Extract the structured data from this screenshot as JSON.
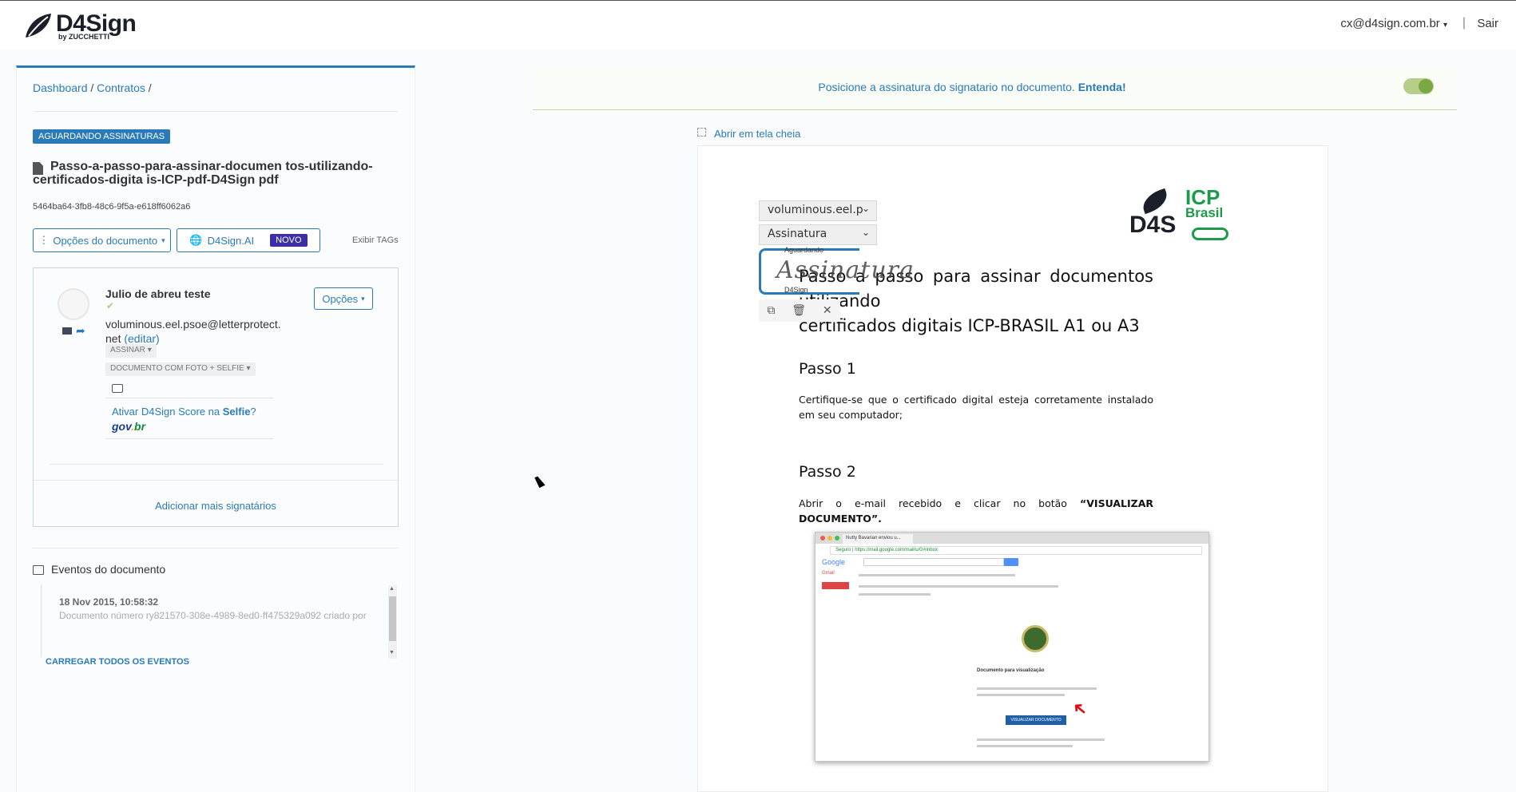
{
  "header": {
    "logo_text": "D4Sign",
    "logo_sub": "by ZUCCHETTI",
    "user_email": "cx@d4sign.com.br",
    "separator": "|",
    "logout": "Sair"
  },
  "breadcrumb": {
    "items": [
      "Dashboard",
      "Contratos"
    ],
    "sep": "/"
  },
  "document": {
    "status": "AGUARDANDO ASSINATURAS",
    "title": "Passo-a-passo-para-assinar-documen tos-utilizando-certificados-digita is-ICP-pdf-D4Sign pdf",
    "hash": "5464ba64-3fb8-48c6-9f5a-e618ff6062a6",
    "options_label": "Opções do documento",
    "ai_label": "D4Sign.AI",
    "ai_badge": "NOVO",
    "tags_label": "Exibir TAGs"
  },
  "signer": {
    "name": "Julio de abreu teste",
    "options_label": "Opções",
    "email": "voluminous.eel.psoe@letterprotect.net",
    "edit_label": "(editar)",
    "action_chip": "ASSINAR",
    "auth_chip": "DOCUMENTO COM FOTO + SELFIE",
    "score_prefix": "Ativar D4Sign Score na ",
    "score_bold": "Selfie",
    "score_suffix": "?",
    "gov_1": "gov",
    "gov_2": ".",
    "gov_3": "br",
    "add_signers": "Adicionar mais signatários"
  },
  "events": {
    "title": "Eventos do documento",
    "first_date": "18 Nov 2015, 10:58:32",
    "first_text": "Documento número ry821570-308e-4989-8ed0-ff475329a092 criado por",
    "load_all": "CARREGAR TODOS OS EVENTOS"
  },
  "viewer": {
    "info_text": "Posicione a assinatura do signatario no documento.",
    "info_link": "Entenda!",
    "fullscreen": "Abrir em tela cheia",
    "select_signer": "voluminous.eel.p",
    "select_type": "Assinatura",
    "sig_top": "Aguardando",
    "sig_script": "Assinatura",
    "sig_bottom": "D4Sign"
  },
  "doc_content": {
    "d4s_logo": "D4S",
    "icp": "ICP",
    "brasil": "Brasil",
    "heading_line1": "Passo a passo para assinar documentos utilizando",
    "heading_line2": "certificados digitais ICP-BRASIL A1 ou A3",
    "step1_title": "Passo 1",
    "step1_text": "Certifique-se que o certificado digital esteja corretamente instalado em seu computador;",
    "step2_title": "Passo 2",
    "step2_text": "Abrir o e-mail recebido e clicar no botão ",
    "step2_bold": "“VISUALIZAR DOCUMENTO”.",
    "shot_tab": "Nutty Bavarian enviou u...",
    "shot_url": "Seguro | https://mail.google.com/mail/u/0/#inbox",
    "shot_google": "Google",
    "shot_gmail": "Gmail",
    "shot_caption": "Documento para visualização",
    "shot_button": "VISUALIZAR DOCUMENTO"
  },
  "colors": {
    "accent": "#2a7ab8",
    "badge_new": "#3a2fa8",
    "icp_green": "#1e9a4b",
    "toggle_on": "#7aa844"
  }
}
